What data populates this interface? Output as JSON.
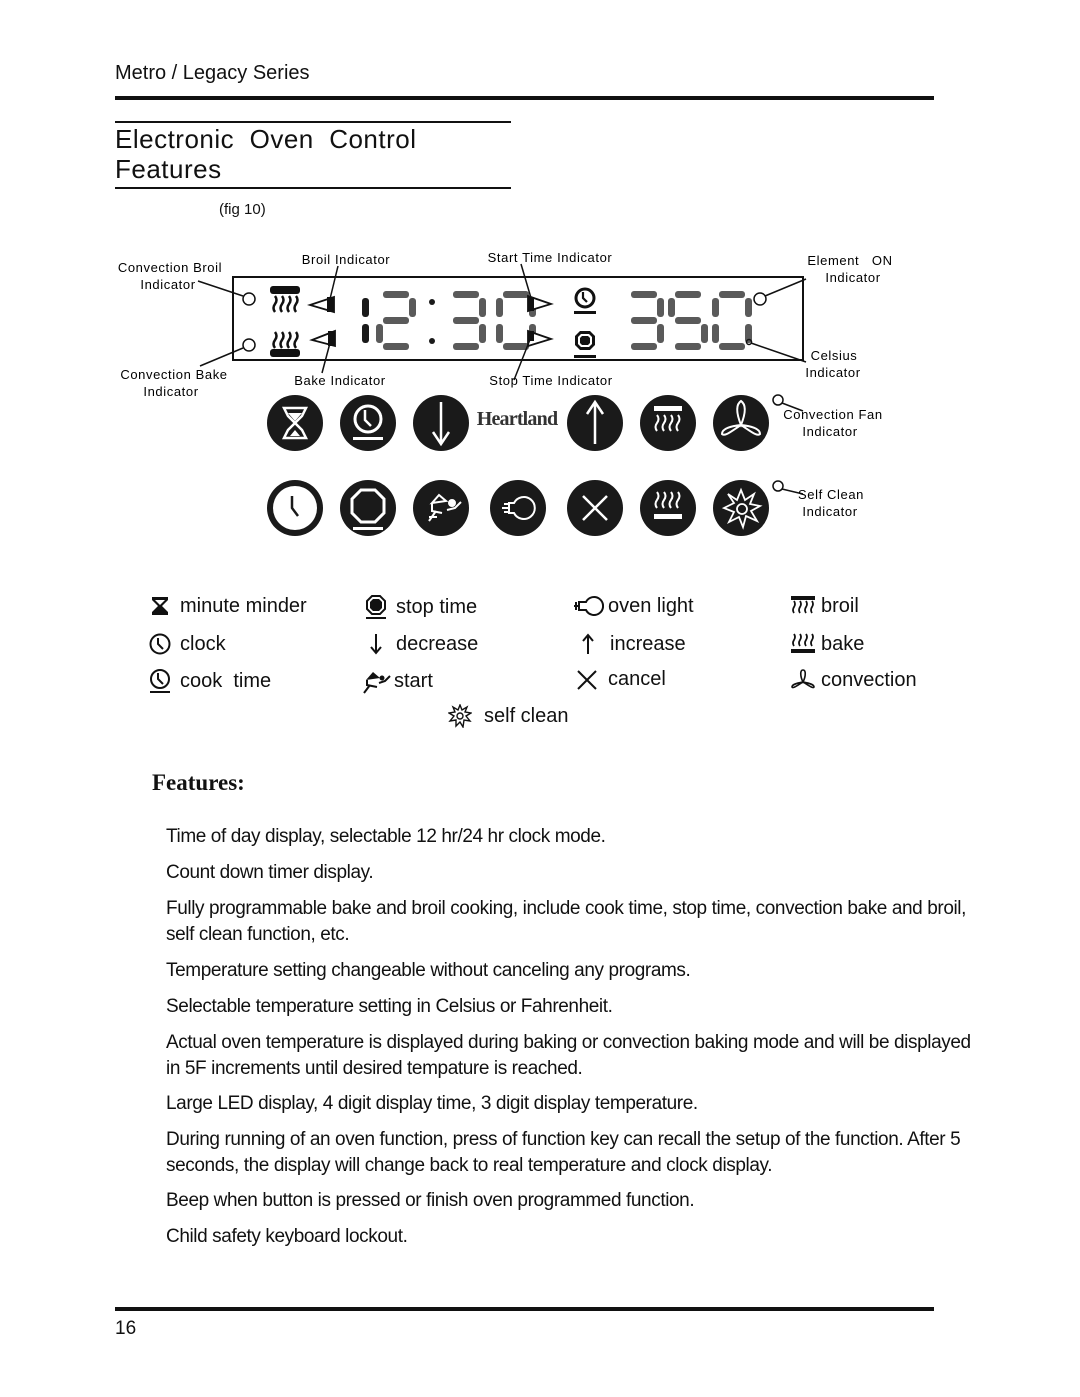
{
  "header": {
    "series": "Metro / Legacy Series"
  },
  "section": {
    "title_line1": "Electronic  Oven  Control",
    "title_line2": "Features",
    "figure_label": "(fig 10)"
  },
  "diagram": {
    "display": {
      "time": "12:30",
      "temperature": "350"
    },
    "callouts": {
      "convection_broil": [
        "Convection  Broil",
        "Indicator"
      ],
      "convection_bake": [
        "Convection  Bake",
        "Indicator"
      ],
      "broil": "Broil  Indicator",
      "bake": "Bake  Indicator",
      "start_time": "Start  Time  Indicator",
      "stop_time": "Stop  Time  Indicator",
      "element_on": [
        "Element   ON",
        "Indicator"
      ],
      "celsius": [
        "Celsius",
        "Indicator"
      ],
      "convection_fan": [
        "Convection  Fan",
        "Indicator"
      ],
      "self_clean": [
        "Self  Clean",
        "Indicator"
      ]
    },
    "brand": "Heartland",
    "keys_row1": [
      "minute-minder",
      "cook-time",
      "decrease",
      "increase",
      "broil",
      "convection"
    ],
    "keys_row2": [
      "clock",
      "stop-time",
      "start",
      "oven-light",
      "cancel",
      "bake",
      "self-clean"
    ]
  },
  "legend": [
    {
      "icon": "hourglass-icon",
      "label": "minute minder"
    },
    {
      "icon": "stop-time-icon",
      "label": "stop time"
    },
    {
      "icon": "light-bulb-icon",
      "label": "oven light"
    },
    {
      "icon": "broil-icon",
      "label": "broil"
    },
    {
      "icon": "clock-icon",
      "label": "clock"
    },
    {
      "icon": "arrow-down-icon",
      "label": "decrease"
    },
    {
      "icon": "arrow-up-icon",
      "label": "increase"
    },
    {
      "icon": "bake-icon",
      "label": "bake"
    },
    {
      "icon": "cook-time-icon",
      "label": "cook  time"
    },
    {
      "icon": "start-icon",
      "label": "start"
    },
    {
      "icon": "cancel-icon",
      "label": "cancel"
    },
    {
      "icon": "fan-icon",
      "label": "convection"
    },
    {
      "icon": "self-clean-icon",
      "label": "self clean"
    }
  ],
  "features": {
    "heading": "Features:",
    "items": [
      "Time of day display, selectable 12 hr/24 hr clock mode.",
      "Count down timer display.",
      "Fully programmable bake and broil cooking, include cook time, stop time, convection bake and broil, self clean function, etc.",
      "Temperature setting changeable without canceling any programs.",
      "Selectable temperature setting in Celsius or Fahrenheit.",
      "Actual oven temperature is displayed during baking or convection baking mode and will be displayed in 5F increments until desired tempature is reached.",
      "Large LED display, 4 digit display time, 3 digit display temperature.",
      "During running of an oven function, press of function key can recall the setup of the function. After 5 seconds, the display will change back to real temperature and clock display.",
      "Beep when button is pressed or finish oven programmed function.",
      "Child safety keyboard lockout."
    ]
  },
  "footer": {
    "page_number": "16"
  }
}
